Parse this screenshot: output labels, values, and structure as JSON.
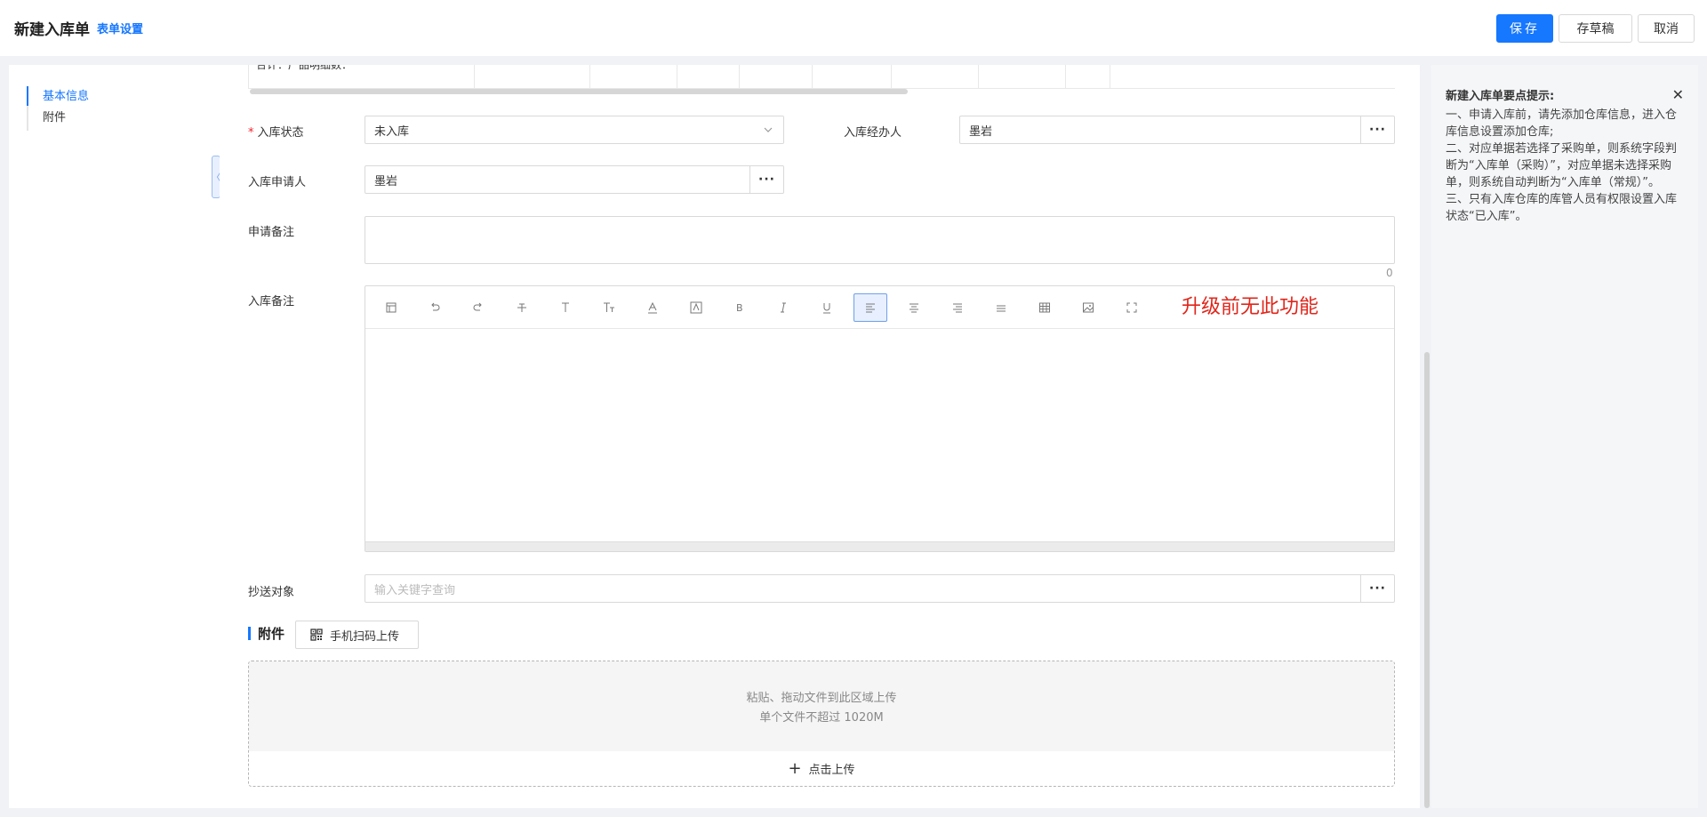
{
  "header": {
    "title": "新建入库单",
    "form_setting": "表单设置",
    "save": "保存",
    "draft": "存草稿",
    "cancel": "取消"
  },
  "nav": {
    "items": [
      {
        "label": "基本信息",
        "active": true
      },
      {
        "label": "附件",
        "active": false
      }
    ]
  },
  "table_fragment": {
    "first_cell": "合计：产品明细数："
  },
  "form": {
    "status": {
      "label": "入库状态",
      "required_mark": "*",
      "value": "未入库"
    },
    "handler": {
      "label": "入库经办人",
      "value": "墨岩"
    },
    "applicant": {
      "label": "入库申请人",
      "value": "墨岩"
    },
    "apply_note": {
      "label": "申请备注",
      "char_count": "0"
    },
    "stock_note": {
      "label": "入库备注",
      "annotation": "升级前无此功能"
    },
    "cc": {
      "label": "抄送对象",
      "placeholder": "输入关键字查询"
    }
  },
  "toolbar_icons": [
    "template-icon",
    "undo-icon",
    "redo-icon",
    "strikethrough-icon",
    "font-size-icon",
    "text-size-icon",
    "font-color-icon",
    "background-color-icon",
    "bold-icon",
    "italic-icon",
    "underline-icon",
    "align-left-icon",
    "align-center-icon",
    "align-right-icon",
    "justify-icon",
    "table-icon",
    "image-icon",
    "fullscreen-icon"
  ],
  "attachment": {
    "title": "附件",
    "qr_button": "手机扫码上传",
    "drop_line1": "粘贴、拖动文件到此区域上传",
    "drop_line2": "单个文件不超过 1020M",
    "upload": "点击上传"
  },
  "tips": {
    "title": "新建入库单要点提示:",
    "lines": [
      "一、申请入库前，请先添加仓库信息，进入仓库信息设置添加仓库;",
      "二、对应单据若选择了采购单，则系统字段判断为“入库单（采购）”，对应单据未选择采购单，则系统自动判断为“入库单（常规）”。",
      "三、只有入库仓库的库管人员有权限设置入库状态“已入库”。"
    ]
  },
  "colors": {
    "accent": "#1677ff",
    "annotation": "#e0261b",
    "required": "#f5222d"
  }
}
